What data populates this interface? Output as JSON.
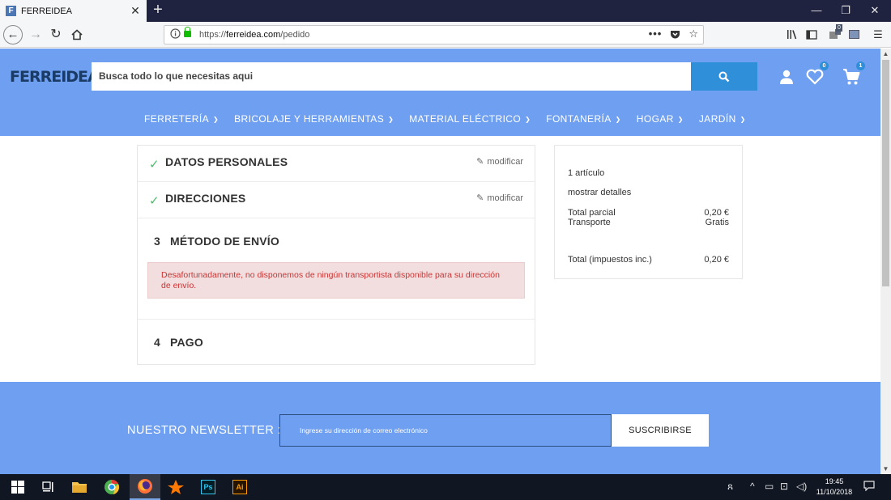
{
  "browser": {
    "tab_title": "FERREIDEA",
    "tab_favicon_letter": "F",
    "url_scheme": "https://",
    "url_host": "ferreidea.com",
    "url_path": "/pedido",
    "tab_close": "✕",
    "new_tab": "+",
    "window_minimize": "—",
    "window_restore": "❐",
    "window_close": "✕",
    "library_badge": "0"
  },
  "header": {
    "logo": "FERREIDEA",
    "search_placeholder": "Busca todo lo que necesitas aqui",
    "wishlist_count": "0",
    "cart_count": "1",
    "menu": [
      {
        "label": "FERRETERÍA"
      },
      {
        "label": "BRICOLAJE Y HERRAMIENTAS"
      },
      {
        "label": "MATERIAL ELÉCTRICO"
      },
      {
        "label": "FONTANERÍA"
      },
      {
        "label": "HOGAR"
      },
      {
        "label": "JARDÍN"
      }
    ]
  },
  "checkout": {
    "steps": [
      {
        "title": "DATOS PERSONALES",
        "edit": "modificar"
      },
      {
        "title": "DIRECCIONES",
        "edit": "modificar"
      },
      {
        "number": "3",
        "title": "MÉTODO DE ENVÍO"
      },
      {
        "number": "4",
        "title": "PAGO"
      }
    ],
    "alert": "Desafortunadamente, no disponemos de ningún transportista disponible para su dirección de envío."
  },
  "summary": {
    "items": "1 artículo",
    "details": "mostrar detalles",
    "subtotal_label": "Total parcial",
    "subtotal_value": "0,20 €",
    "shipping_label": "Transporte",
    "shipping_value": "Gratis",
    "total_label": "Total (impuestos inc.)",
    "total_value": "0,20 €"
  },
  "newsletter": {
    "label": "NUESTRO NEWSLETTER :",
    "placeholder": "Ingrese su dirección de correo electrónico",
    "button": "SUSCRIBIRSE"
  },
  "taskbar": {
    "time": "19:45",
    "date": "11/10/2018",
    "ps_label": "Ps",
    "ai_label": "Ai"
  },
  "colors": {
    "header_bg": "#6e9ff0",
    "search_button": "#2f8fd8",
    "check": "#4cbb6c",
    "alert_bg": "#f2dede",
    "alert_text": "#cc3333"
  }
}
